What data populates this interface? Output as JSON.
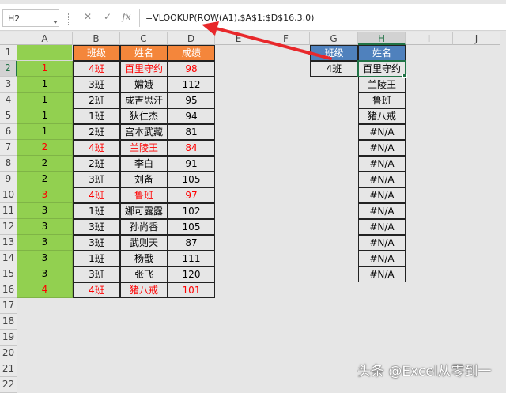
{
  "name_box": "H2",
  "formula_icons": {
    "cancel": "✕",
    "enter": "✓",
    "fx": "fx"
  },
  "formula": "=VLOOKUP(ROW(A1),$A$1:$D$16,3,0)",
  "columns": [
    "A",
    "B",
    "C",
    "D",
    "E",
    "F",
    "G",
    "H",
    "I",
    "J"
  ],
  "rows": [
    "1",
    "2",
    "3",
    "4",
    "5",
    "6",
    "7",
    "8",
    "9",
    "10",
    "11",
    "12",
    "13",
    "14",
    "15",
    "16",
    "17",
    "18",
    "19",
    "20",
    "21",
    "22"
  ],
  "table_header": [
    "班级",
    "姓名",
    "成绩"
  ],
  "table_rows": [
    {
      "a": "1",
      "b": "4班",
      "c": "百里守约",
      "d": "98",
      "red": true
    },
    {
      "a": "1",
      "b": "3班",
      "c": "嫦娥",
      "d": "112",
      "red": false
    },
    {
      "a": "1",
      "b": "2班",
      "c": "成吉思汗",
      "d": "95",
      "red": false
    },
    {
      "a": "1",
      "b": "1班",
      "c": "狄仁杰",
      "d": "94",
      "red": false
    },
    {
      "a": "1",
      "b": "2班",
      "c": "宫本武藏",
      "d": "81",
      "red": false
    },
    {
      "a": "2",
      "b": "4班",
      "c": "兰陵王",
      "d": "84",
      "red": true
    },
    {
      "a": "2",
      "b": "2班",
      "c": "李白",
      "d": "91",
      "red": false
    },
    {
      "a": "2",
      "b": "3班",
      "c": "刘备",
      "d": "105",
      "red": false
    },
    {
      "a": "3",
      "b": "4班",
      "c": "鲁班",
      "d": "97",
      "red": true
    },
    {
      "a": "3",
      "b": "1班",
      "c": "娜可露露",
      "d": "102",
      "red": false
    },
    {
      "a": "3",
      "b": "3班",
      "c": "孙尚香",
      "d": "105",
      "red": false
    },
    {
      "a": "3",
      "b": "3班",
      "c": "武则天",
      "d": "87",
      "red": false
    },
    {
      "a": "3",
      "b": "1班",
      "c": "杨戬",
      "d": "111",
      "red": false
    },
    {
      "a": "3",
      "b": "3班",
      "c": "张飞",
      "d": "120",
      "red": false
    },
    {
      "a": "4",
      "b": "4班",
      "c": "猪八戒",
      "d": "101",
      "red": true
    }
  ],
  "lookup_header": [
    "班级",
    "姓名"
  ],
  "lookup_class": "4班",
  "lookup_results": [
    "百里守约",
    "兰陵王",
    "鲁班",
    "猪八戒",
    "#N/A",
    "#N/A",
    "#N/A",
    "#N/A",
    "#N/A",
    "#N/A",
    "#N/A",
    "#N/A",
    "#N/A",
    "#N/A"
  ],
  "watermark": "头条 @Excel从零到一",
  "colors": {
    "green_fill": "#92d050",
    "orange_fill": "#f4863b",
    "blue_fill": "#4f81bd",
    "red_text": "#ff0000",
    "accent": "#217346",
    "arrow": "#e8282b"
  }
}
